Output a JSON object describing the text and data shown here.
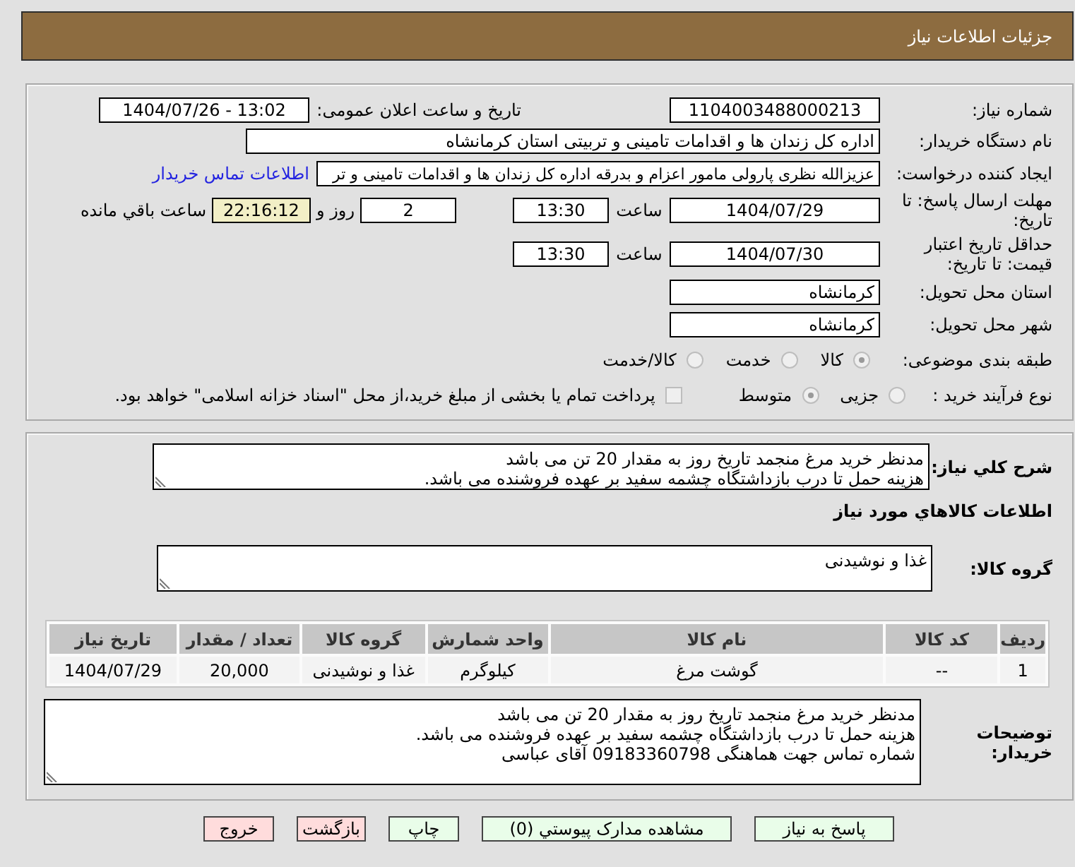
{
  "header": {
    "title": "جزئیات اطلاعات نیاز"
  },
  "details": {
    "need_number": {
      "label": "شماره نیاز:",
      "value": "1104003488000213"
    },
    "announcement": {
      "label": "تاریخ و ساعت اعلان عمومی:",
      "value": "1404/07/26 - 13:02"
    },
    "buyer_organization": {
      "label": "نام دستگاه خریدار:",
      "value": "اداره کل زندان ها و اقدامات تامینی و تربیتی استان کرمانشاه"
    },
    "requester": {
      "label": "ایجاد کننده درخواست:",
      "value": "عزیزالله نظری پارولی مامور اعزام و بدرقه اداره کل زندان ها و اقدامات تامینی و تر",
      "link": "اطلاعات تماس خریدار"
    },
    "response_deadline": {
      "label": "مهلت ارسال پاسخ: تا تاریخ:",
      "date": "1404/07/29",
      "time_label": "ساعت",
      "time": "13:30",
      "days": "2",
      "days_label": "روز و",
      "remaining": "22:16:12",
      "remaining_label": "ساعت باقي مانده"
    },
    "price_validity": {
      "label": "حداقل تاریخ اعتبار قیمت: تا تاریخ:",
      "date": "1404/07/30",
      "time_label": "ساعت",
      "time": "13:30"
    },
    "delivery_province": {
      "label": "استان محل تحویل:",
      "value": "کرمانشاه"
    },
    "delivery_city": {
      "label": "شهر محل تحویل:",
      "value": "کرمانشاه"
    },
    "subject_category": {
      "label": "طبقه بندی موضوعی:",
      "options": [
        {
          "label": "کالا",
          "selected": true
        },
        {
          "label": "خدمت",
          "selected": false
        },
        {
          "label": "کالا/خدمت",
          "selected": false
        }
      ]
    },
    "purchase_type": {
      "label": "نوع فرآیند خرید :",
      "options": [
        {
          "label": "جزیی",
          "selected": false
        },
        {
          "label": "متوسط",
          "selected": true
        }
      ],
      "treasury_option": {
        "label": "پرداخت تمام یا بخشی از مبلغ خرید،از محل \"اسناد خزانه اسلامی\" خواهد بود.",
        "checked": false
      }
    }
  },
  "needs": {
    "description": {
      "label": "شرح کلي نياز:",
      "lines": [
        "مدنظر خرید مرغ منجمد تاریخ روز به مقدار 20 تن می باشد",
        "هزینه حمل تا درب بازداشتگاه چشمه سفید بر عهده فروشنده می باشد."
      ]
    },
    "section_title": "اطلاعات کالاهاي مورد نياز",
    "goods_group": {
      "label": "گروه کالا:",
      "value": "غذا و نوشیدنی"
    },
    "table": {
      "columns": [
        "ردیف",
        "کد کالا",
        "نام کالا",
        "واحد شمارش",
        "گروه کالا",
        "تعداد / مقدار",
        "تاریخ نیاز"
      ],
      "rows": [
        [
          "1",
          "--",
          "گوشت مرغ",
          "کیلوگرم",
          "غذا و نوشیدنی",
          "20,000",
          "1404/07/29"
        ]
      ]
    },
    "buyer_notes": {
      "label": "توضیحات خریدار:",
      "lines": [
        "مدنظر خرید مرغ منجمد تاریخ روز به مقدار 20 تن می باشد",
        "هزینه حمل تا درب بازداشتگاه چشمه سفید بر عهده فروشنده می باشد.",
        "شماره تماس جهت هماهنگی 09183360798 آقای عباسی"
      ]
    }
  },
  "buttons": [
    {
      "label": "پاسخ به نیاز",
      "kind": "action"
    },
    {
      "label": "مشاهده مدارک پیوستي (0)",
      "kind": "action"
    },
    {
      "label": "چاپ",
      "kind": "action"
    },
    {
      "label": "بازگشت",
      "kind": "exit"
    },
    {
      "label": "خروج",
      "kind": "exit"
    }
  ]
}
